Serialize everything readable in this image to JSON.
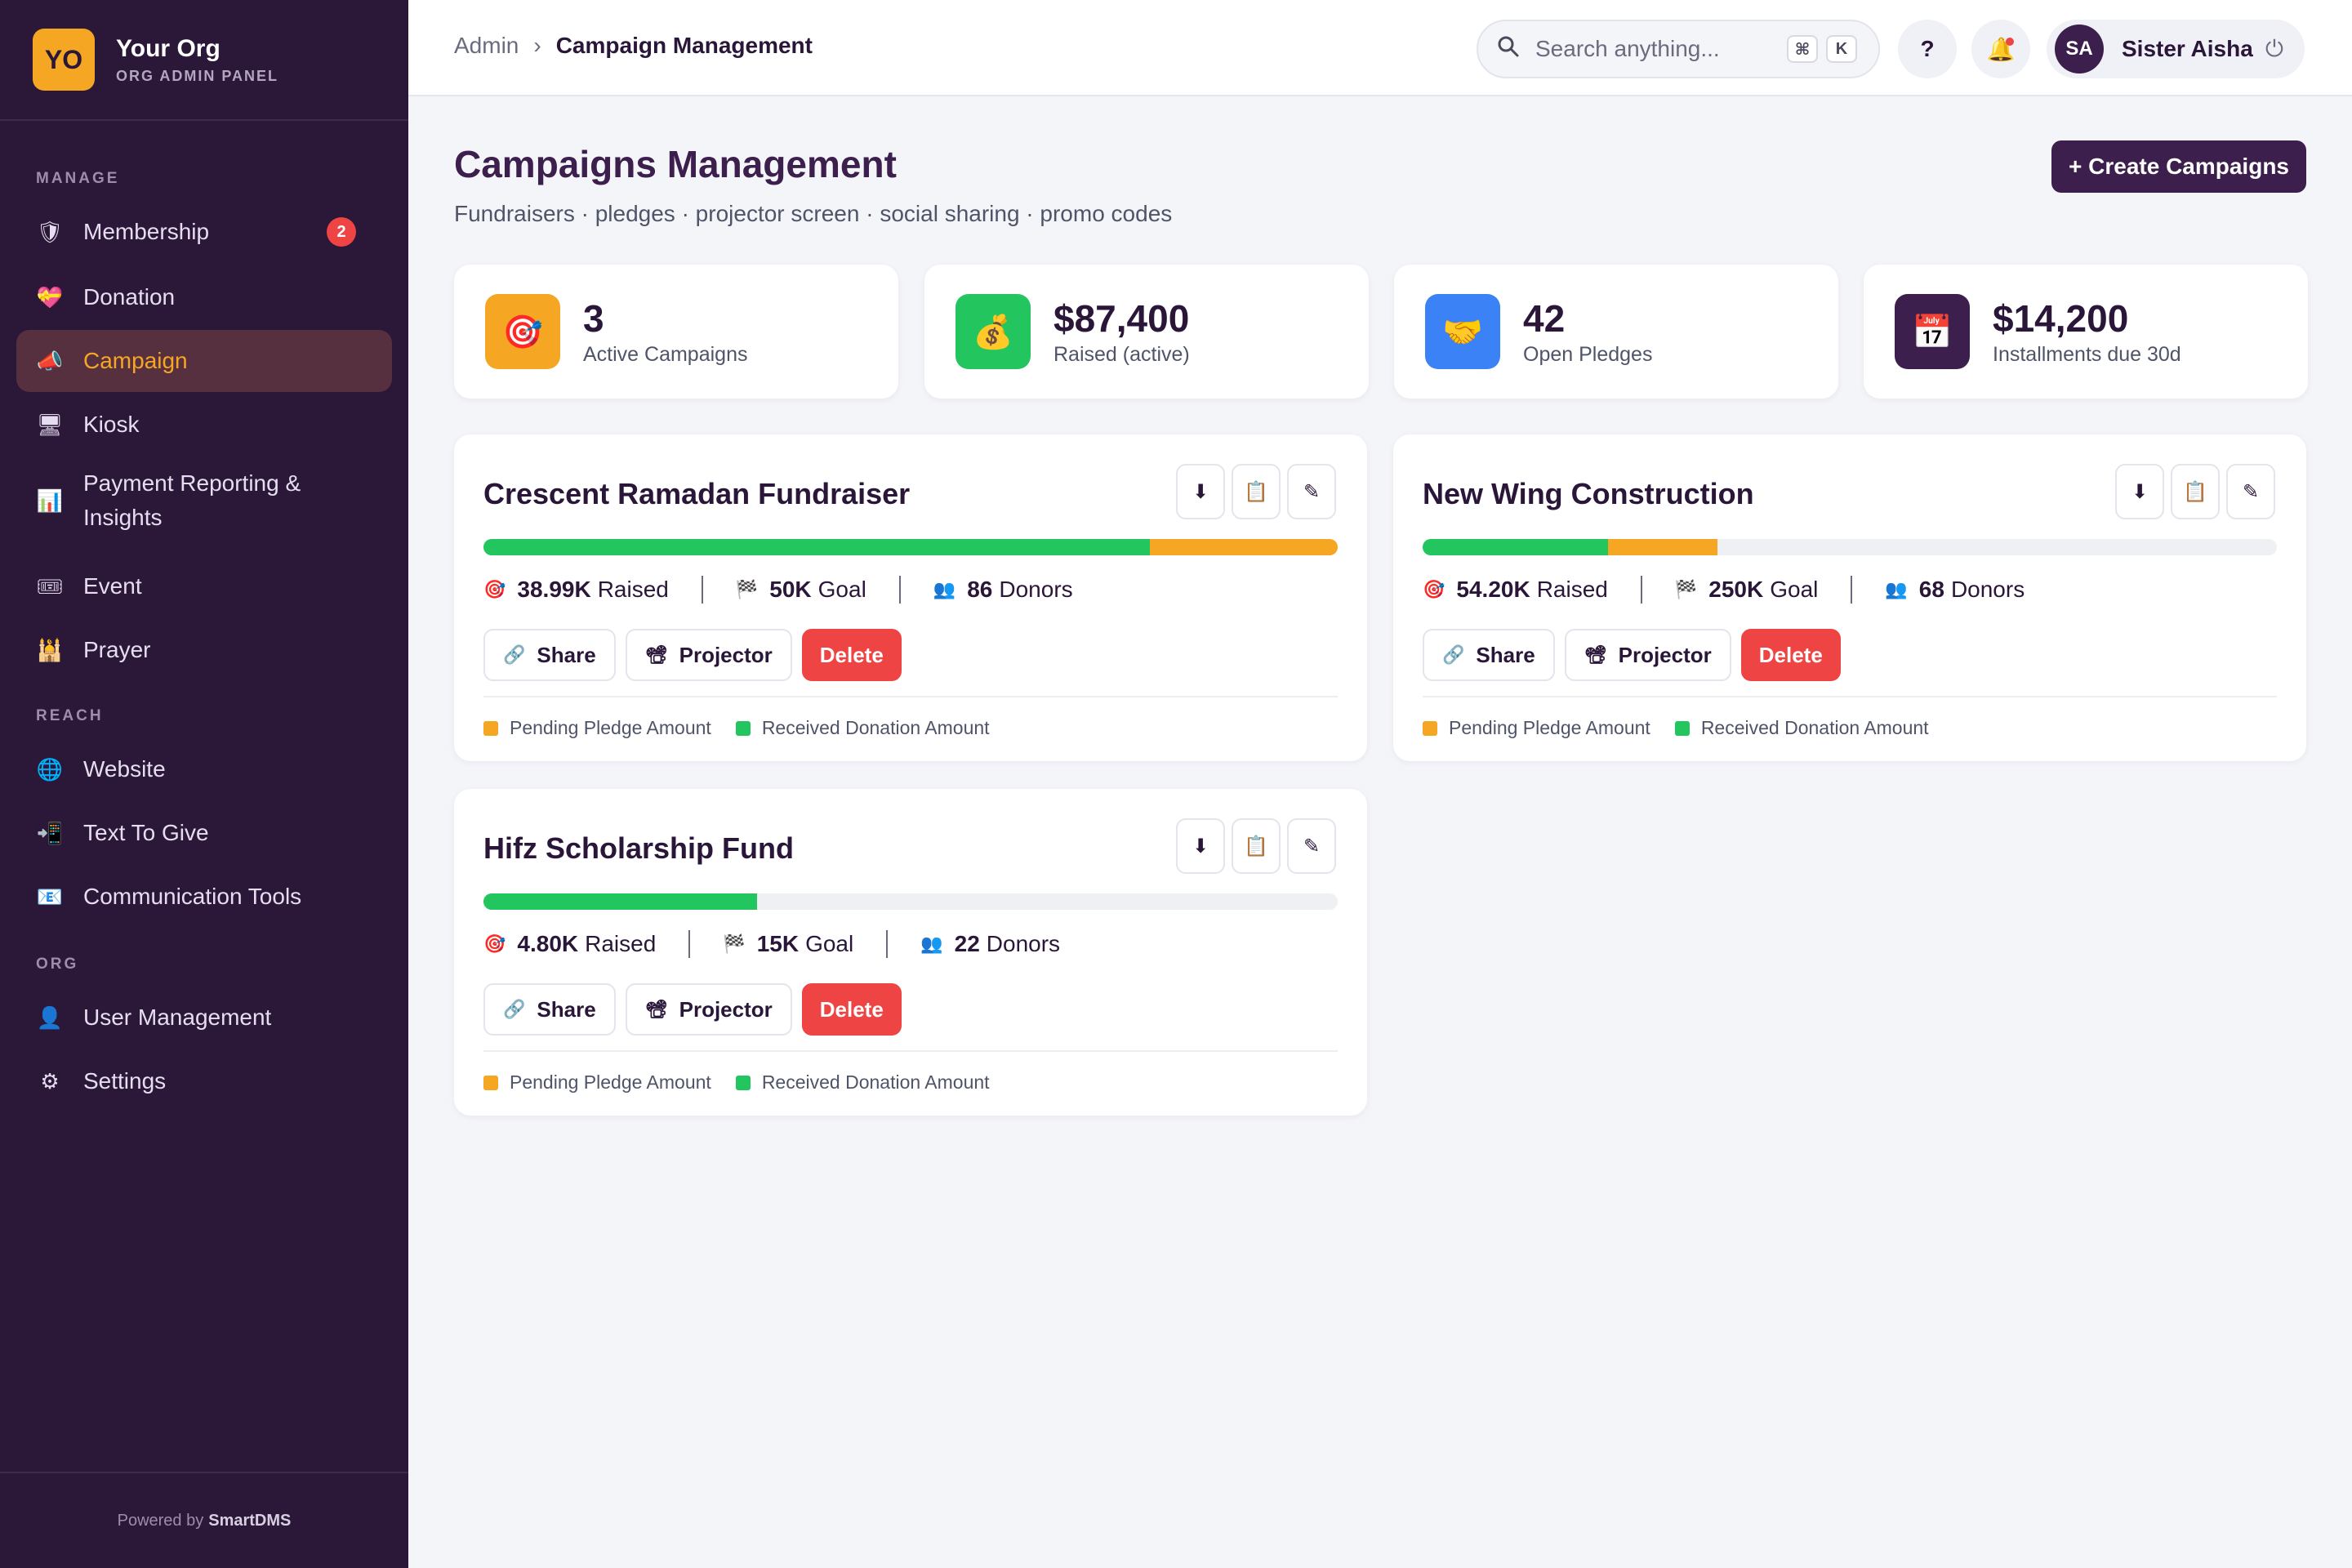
{
  "brand": {
    "logo": "YO",
    "name": "Your Org",
    "sub": "ORG ADMIN PANEL"
  },
  "sidebar": {
    "sections": {
      "manage": "MANAGE",
      "reach": "REACH",
      "org": "ORG"
    },
    "items": [
      {
        "label": "Membership",
        "icon": "shield-icon",
        "glyph": "🛡",
        "badge": "2"
      },
      {
        "label": "Donation",
        "icon": "heart-gift-icon",
        "glyph": "💝"
      },
      {
        "label": "Campaign",
        "icon": "megaphone-icon",
        "glyph": "📣",
        "active": true
      },
      {
        "label": "Kiosk",
        "icon": "monitor-icon",
        "glyph": "🖥"
      },
      {
        "label": "Payment Reporting & Insights",
        "icon": "bar-chart-icon",
        "glyph": "📊"
      },
      {
        "label": "Event",
        "icon": "ticket-icon",
        "glyph": "🎟"
      },
      {
        "label": "Prayer",
        "icon": "mosque-icon",
        "glyph": "🕌"
      },
      {
        "label": "Website",
        "icon": "globe-icon",
        "glyph": "🌐"
      },
      {
        "label": "Text To Give",
        "icon": "phone-icon",
        "glyph": "📲"
      },
      {
        "label": "Communication Tools",
        "icon": "mail-icon",
        "glyph": "📧"
      },
      {
        "label": "User Management",
        "icon": "user-icon",
        "glyph": "👤"
      },
      {
        "label": "Settings",
        "icon": "gear-icon",
        "glyph": "⚙"
      }
    ],
    "footer_prefix": "Powered by",
    "footer_brand": "SmartDMS"
  },
  "header": {
    "breadcrumb_root": "Admin",
    "breadcrumb_sep": "›",
    "breadcrumb_current": "Campaign Management",
    "search_placeholder": "Search anything...",
    "kbd_cmd": "⌘",
    "kbd_key": "K",
    "help_label": "?",
    "user_initials": "SA",
    "user_name": "Sister Aisha"
  },
  "page": {
    "title": "Campaigns Management",
    "subtitle": "Fundraisers · pledges · projector screen · social sharing · promo codes",
    "create_label": "+ Create Campaigns"
  },
  "stats": [
    {
      "value": "3",
      "label": "Active Campaigns",
      "icon": "target-icon",
      "glyph": "🎯",
      "color": "#f5a623"
    },
    {
      "value": "$87,400",
      "label": "Raised (active)",
      "icon": "money-bag-icon",
      "glyph": "💰",
      "color": "#22c55e"
    },
    {
      "value": "42",
      "label": "Open Pledges",
      "icon": "handshake-icon",
      "glyph": "🤝",
      "color": "#3b82f6"
    },
    {
      "value": "$14,200",
      "label": "Installments due 30d",
      "icon": "calendar-icon",
      "glyph": "📅",
      "color": "#3d1f4d"
    }
  ],
  "campaigns": [
    {
      "title": "Crescent Ramadan Fundraiser",
      "raised": "38.99K",
      "goal": "50K",
      "donors": "86",
      "received_fraction": 0.78,
      "pending_fraction": 0.22
    },
    {
      "title": "New Wing Construction",
      "raised": "54.20K",
      "goal": "250K",
      "donors": "68",
      "received_fraction": 0.217,
      "pending_fraction": 0.128
    },
    {
      "title": "Hifz Scholarship Fund",
      "raised": "4.80K",
      "goal": "15K",
      "donors": "22",
      "received_fraction": 0.32,
      "pending_fraction": 0.0
    }
  ],
  "labels": {
    "raised": "Raised",
    "goal": "Goal",
    "donors": "Donors",
    "share": "Share",
    "projector": "Projector",
    "delete": "Delete",
    "pending_legend": "Pending Pledge Amount",
    "received_legend": "Received Donation Amount"
  },
  "colors": {
    "accent": "#f5a623",
    "brand": "#3d1f4d",
    "received": "#22c55e",
    "pending": "#f5a623",
    "danger": "#ef4444"
  }
}
